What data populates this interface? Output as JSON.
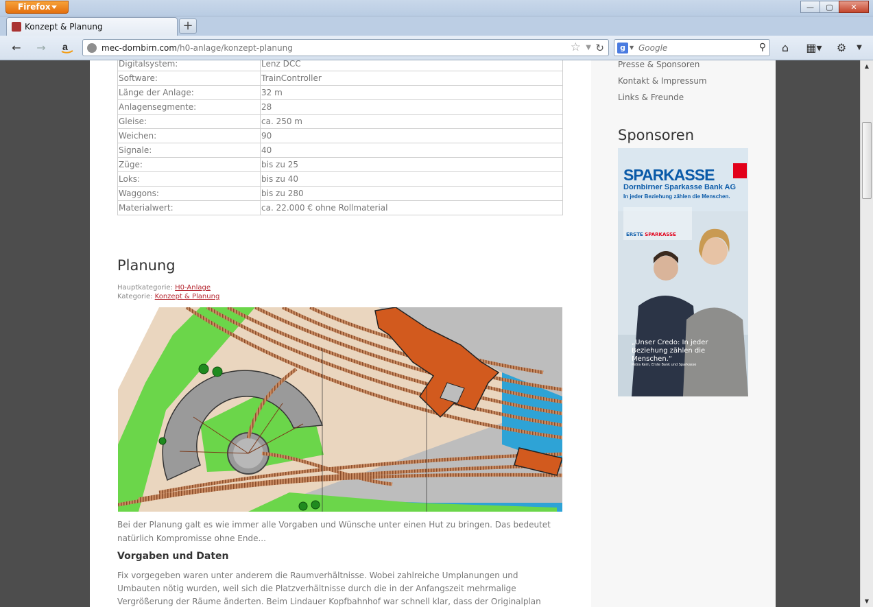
{
  "browser": {
    "app_button": "Firefox",
    "tab_title": "Konzept & Planung",
    "new_tab": "+",
    "url_host": "mec-dornbirn.com",
    "url_path": "/h0-anlage/konzept-planung",
    "search_placeholder": "Google",
    "search_engine_letter": "g",
    "window_controls": {
      "minimize": "—",
      "maximize": "▢",
      "close": "✕"
    }
  },
  "specs": [
    {
      "key": "Digitalsystem:",
      "value": "Lenz DCC"
    },
    {
      "key": "Software:",
      "value": "TrainController"
    },
    {
      "key": "Länge der Anlage:",
      "value": "32 m"
    },
    {
      "key": "Anlagensegmente:",
      "value": "28"
    },
    {
      "key": "Gleise:",
      "value": "ca. 250 m"
    },
    {
      "key": "Weichen:",
      "value": "90"
    },
    {
      "key": "Signale:",
      "value": "40"
    },
    {
      "key": "Züge:",
      "value": "bis zu 25"
    },
    {
      "key": "Loks:",
      "value": "bis zu 40"
    },
    {
      "key": "Waggons:",
      "value": "bis zu 280"
    },
    {
      "key": "Materialwert:",
      "value": "ca. 22.000 € ohne Rollmaterial"
    }
  ],
  "article": {
    "heading": "Planung",
    "main_category_label": "Hauptkategorie:",
    "main_category": "H0-Anlage",
    "category_label": "Kategorie:",
    "category": "Konzept & Planung",
    "intro": "Bei der Planung galt es wie immer alle Vorgaben und Wünsche unter einen Hut zu bringen. Das bedeutet natürlich Kompromisse ohne Ende...",
    "subheading": "Vorgaben und Daten",
    "body": "Fix vorgegeben waren unter anderem die Raumverhältnisse. Wobei zahlreiche Umplanungen und Umbauten nötig wurden, weil sich die Platzverhältnisse durch die in der Anfangszeit mehrmalige Vergrößerung der Räume änderten. Beim Lindauer Kopfbahnhof war schnell klar, dass der Originalplan nicht komplett umgesetzt werden konnte. Ein"
  },
  "sidebar": {
    "links": [
      "Presse & Sponsoren",
      "Kontakt & Impressum",
      "Links & Freunde"
    ],
    "sponsors_heading": "Sponsoren",
    "ad": {
      "brand": "SPARKASSE",
      "bank": "Dornbirner Sparkasse Bank AG",
      "slogan": "In jeder Beziehung zählen die Menschen.",
      "erste": "ERSTE",
      "erste_brand": "SPARKASSE",
      "quote": "„Unser Credo: In jeder Beziehung zählen die Menschen.“",
      "quote_author": "Petra Kern, Erste Bank und Sparkasse"
    }
  },
  "colors": {
    "accent_link": "#b5252f",
    "sparkasse_red": "#e2001a",
    "sparkasse_blue": "#0a5aa8",
    "water": "#2ea3d6",
    "grass": "#6bd64a",
    "building": "#d25a1e"
  }
}
